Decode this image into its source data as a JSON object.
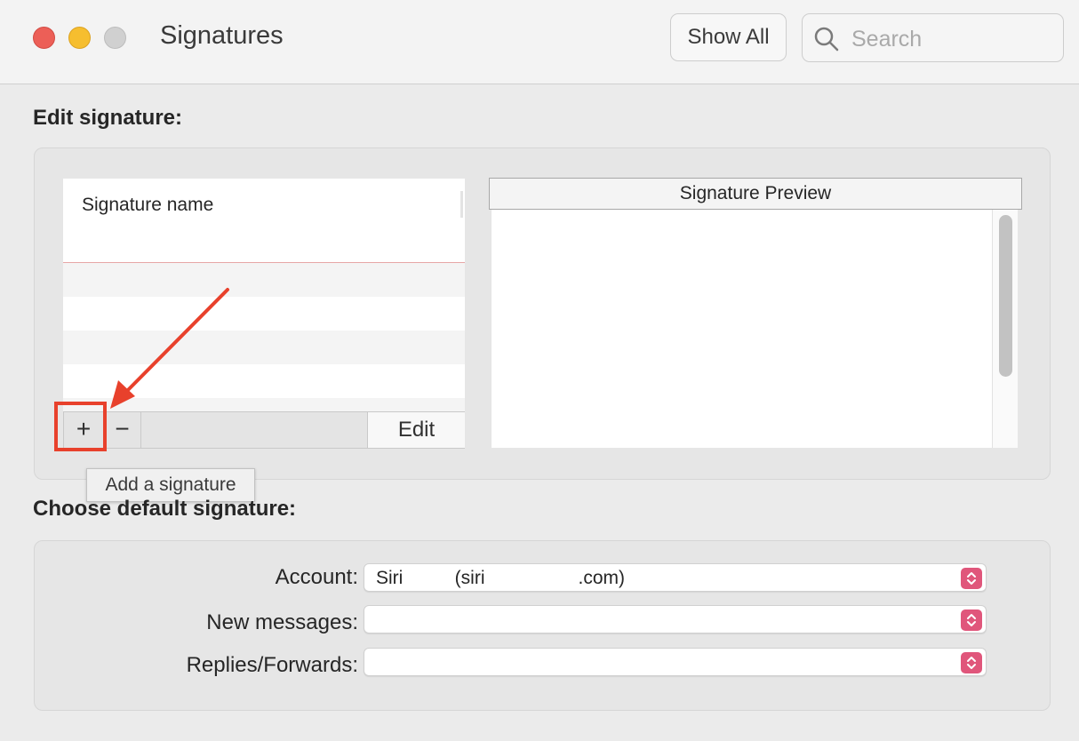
{
  "window": {
    "title": "Signatures",
    "traffic_lights": {
      "close": "#ec5f57",
      "minimize": "#f6be2f",
      "zoom": "#d0d0d0"
    },
    "show_all_label": "Show All",
    "search_placeholder": "Search"
  },
  "edit_section": {
    "heading": "Edit signature:",
    "list": {
      "column_header": "Signature name"
    },
    "toolbar": {
      "add_label": "+",
      "remove_label": "−",
      "edit_label": "Edit"
    },
    "tooltip": "Add a signature",
    "preview_header": "Signature Preview"
  },
  "default_section": {
    "heading": "Choose default signature:",
    "account": {
      "label": "Account:",
      "value": "Siri          (siri                  .com)"
    },
    "new_messages": {
      "label": "New messages:",
      "value": ""
    },
    "replies_forwards": {
      "label": "Replies/Forwards:",
      "value": ""
    }
  },
  "colors": {
    "accent_stepper": "#e0567b",
    "annotation": "#e8412c"
  }
}
